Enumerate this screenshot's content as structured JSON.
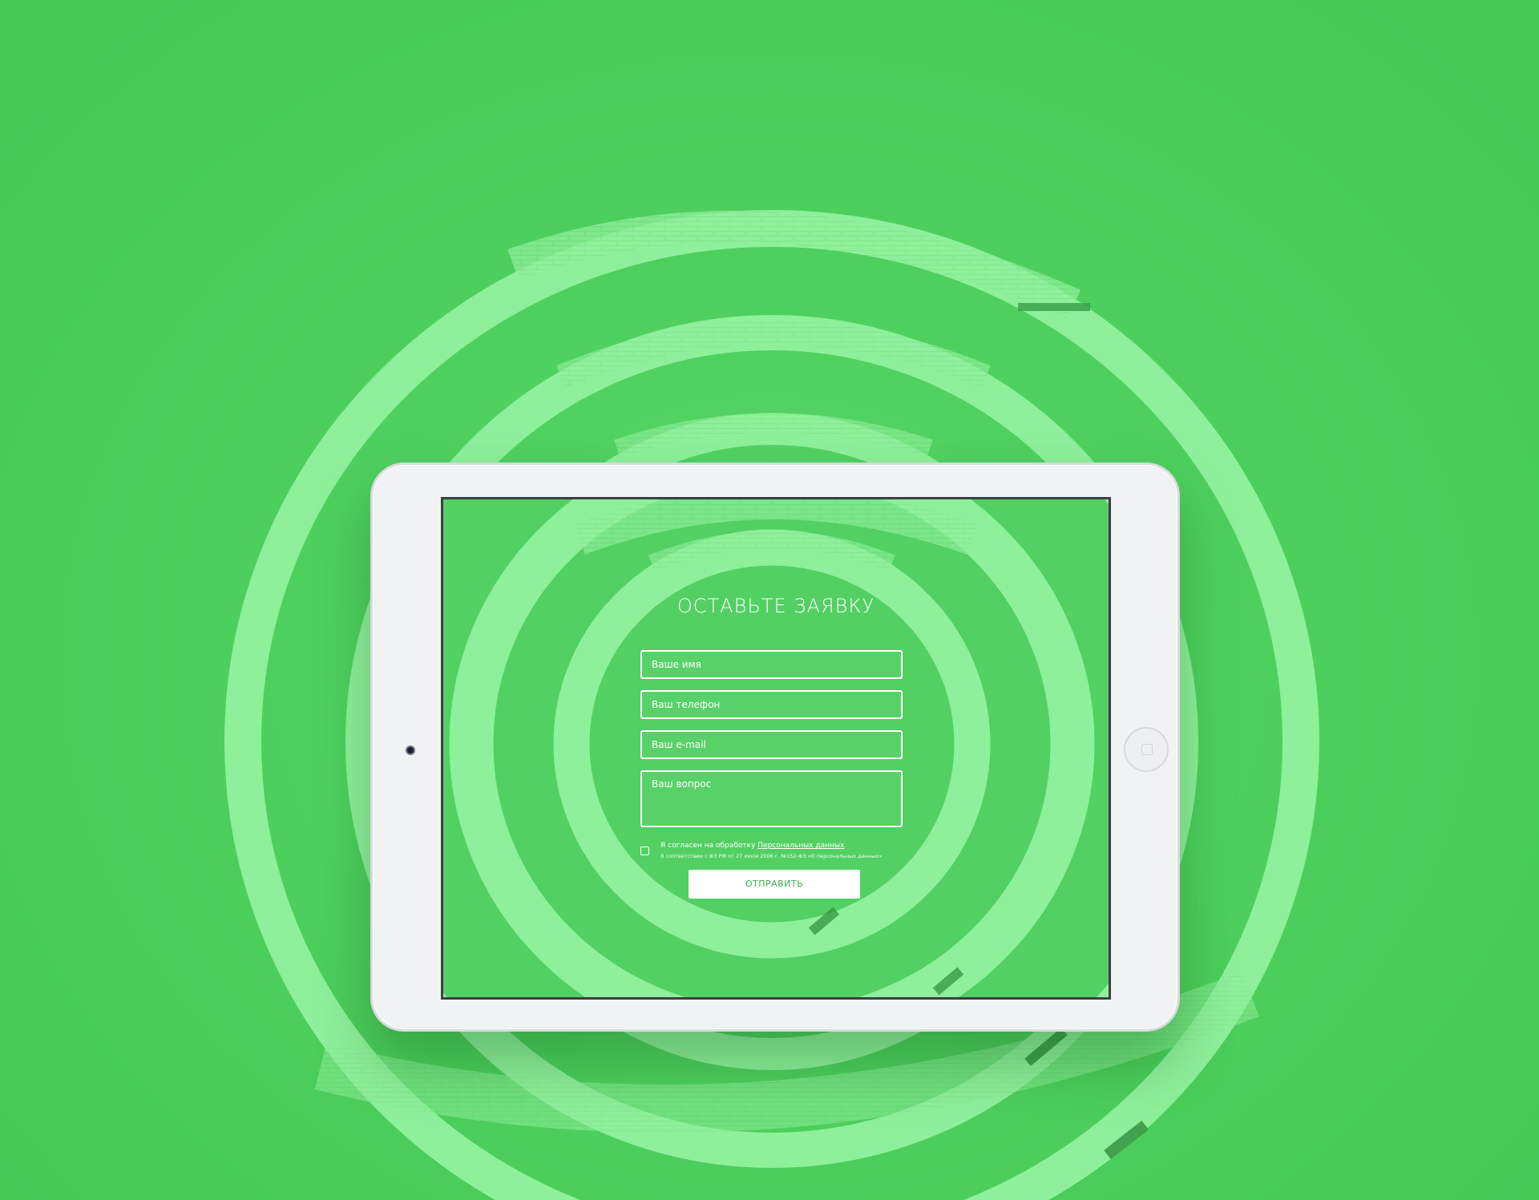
{
  "form": {
    "title": "ОСТАВЬТЕ ЗАЯВКУ",
    "name_placeholder": "Ваше имя",
    "phone_placeholder": "Ваш телефон",
    "email_placeholder": "Ваш e-mail",
    "question_placeholder": "Ваш вопрос",
    "consent_text": "Я согласен на обработку ",
    "consent_link": "Персональных данных",
    "consent_note": "В соответствии с ФЗ РФ от 27 июля 2006 г. №152-ФЗ «О персональных данных»",
    "consent_checked": false,
    "submit_label": "ОТПРАВИТЬ"
  },
  "colors": {
    "background": "#4ccd5b",
    "ring": "#8ef09a",
    "button_text": "#3fae4f",
    "tablet_body": "#f1f2f3"
  },
  "icons": [
    "tablet-camera-icon",
    "tablet-home-button-icon",
    "checkbox-icon"
  ]
}
